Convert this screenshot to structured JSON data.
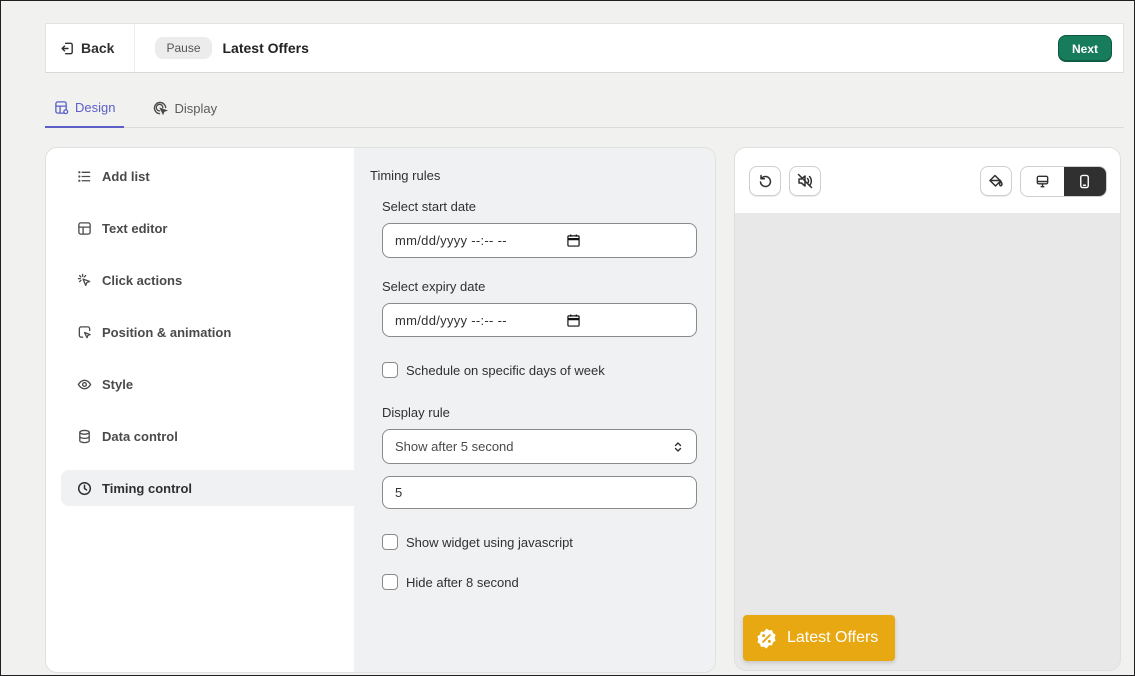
{
  "header": {
    "back_label": "Back",
    "status_badge": "Pause",
    "title": "Latest Offers",
    "next_label": "Next"
  },
  "tabs": [
    {
      "label": "Design",
      "icon": "layout-icon",
      "active": true
    },
    {
      "label": "Display",
      "icon": "target-pointer-icon",
      "active": false
    }
  ],
  "menu": {
    "items": [
      {
        "label": "Add list",
        "icon": "list-icon"
      },
      {
        "label": "Text editor",
        "icon": "layout-panel-icon"
      },
      {
        "label": "Click actions",
        "icon": "click-sparkle-icon"
      },
      {
        "label": "Position & animation",
        "icon": "cursor-frame-icon"
      },
      {
        "label": "Style",
        "icon": "eye-icon"
      },
      {
        "label": "Data control",
        "icon": "database-icon"
      },
      {
        "label": "Timing control",
        "icon": "clock-icon",
        "active": true
      }
    ]
  },
  "timing": {
    "section_title": "Timing rules",
    "start_label": "Select start date",
    "start_placeholder": "mm/dd/yyyy --:-- --",
    "expiry_label": "Select expiry date",
    "expiry_placeholder": "mm/dd/yyyy --:-- --",
    "schedule_label": "Schedule on specific days of week",
    "display_rule_label": "Display rule",
    "display_rule_value": "Show after 5 second",
    "seconds_value": "5",
    "javascript_label": "Show widget using javascript",
    "hide_label": "Hide after 8 second"
  },
  "preview": {
    "widget_label": "Latest Offers"
  },
  "colors": {
    "accent": "#5b5fc7",
    "primary_button": "#177c5b",
    "widget": "#e7a811"
  }
}
